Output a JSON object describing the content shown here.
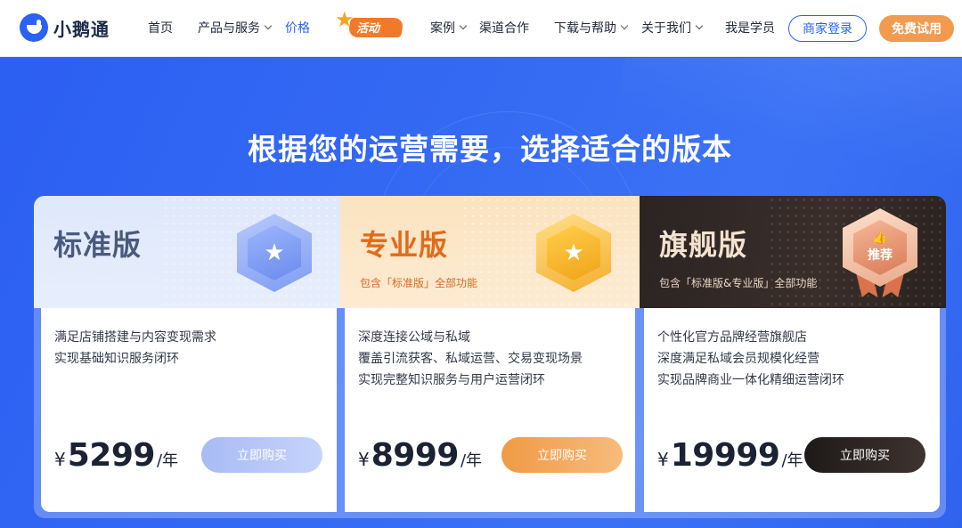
{
  "header": {
    "logo_text": "小鹅通",
    "nav": [
      {
        "label": "首页",
        "dropdown": false
      },
      {
        "label": "产品与服务",
        "dropdown": true
      },
      {
        "label": "价格",
        "dropdown": false,
        "active": true
      },
      {
        "label": "案例",
        "dropdown": true
      },
      {
        "label": "渠道合作",
        "dropdown": false
      },
      {
        "label": "下载与帮助",
        "dropdown": true
      },
      {
        "label": "关于我们",
        "dropdown": true
      },
      {
        "label": "我是学员",
        "dropdown": false
      }
    ],
    "activity_label": "活动",
    "login_label": "商家登录",
    "trial_label": "免费试用"
  },
  "hero": {
    "title": "根据您的运营需要，选择适合的版本"
  },
  "plans": [
    {
      "name": "标准版",
      "subtitle": "",
      "features": [
        "满足店铺搭建与内容变现需求",
        "实现基础知识服务闭环"
      ],
      "currency": "¥",
      "price": "5299",
      "unit": "/年",
      "buy_label": "立即购买"
    },
    {
      "name": "专业版",
      "subtitle": "包含「标准版」全部功能",
      "features": [
        "深度连接公域与私域",
        "覆盖引流获客、私域运营、交易变现场景",
        "实现完整知识服务与用户运营闭环"
      ],
      "currency": "¥",
      "price": "8999",
      "unit": "/年",
      "buy_label": "立即购买"
    },
    {
      "name": "旗舰版",
      "subtitle": "包含「标准版&专业版」全部功能",
      "badge_label": "推荐",
      "features": [
        "个性化官方品牌经营旗舰店",
        "深度满足私域会员规模化经营",
        "实现品牌商业一体化精细运营闭环"
      ],
      "currency": "¥",
      "price": "19999",
      "unit": "/年",
      "buy_label": "立即购买"
    }
  ],
  "colors": {
    "primary": "#2a62f4",
    "trial": "#f39a4f",
    "pro_accent": "#e26a1a",
    "flagship_dark": "#2b2422"
  }
}
